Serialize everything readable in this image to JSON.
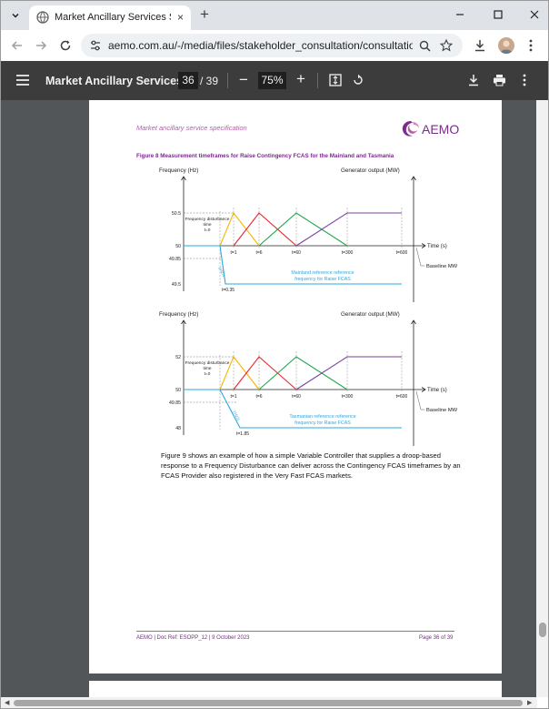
{
  "browser": {
    "tab_title": "Market Ancillary Services Specif...",
    "url": "aemo.com.au/-/media/files/stakeholder_consultation/consultations/...",
    "close_glyph": "×",
    "new_tab_glyph": "+",
    "window_minimize": "—",
    "window_maximize": "☐",
    "window_close": "✕"
  },
  "pdf_toolbar": {
    "title": "Market Ancillary Services...",
    "current_page": "36",
    "total_pages": "/ 39",
    "zoom": "75%",
    "minus": "−",
    "plus": "+"
  },
  "document": {
    "header": "Market ancillary service specification",
    "logo_text": "AEMO",
    "figure_caption": "Figure 8    Measurement timeframes for Raise Contingency FCAS for the Mainland and Tasmania",
    "body_paragraph": "Figure 9 shows an example of how a simple Variable Controller that supplies a droop-based response to a Frequency Disturbance can deliver across the Contingency FCAS timeframes by an FCAS Provider also registered in the Very Fast FCAS markets.",
    "footer_left": "AEMO | Doc Ref: ESOPP_12 | 9 October 2023",
    "footer_right": "Page 36 of 39"
  },
  "chart_data": [
    {
      "type": "line",
      "panel": "mainland",
      "ylabel": "Frequency (Hz)",
      "y2label": "Generator output (MW)",
      "xlabel": "Time (s)",
      "y_ticks": [
        "50.5",
        "50",
        "49.85",
        "49.5"
      ],
      "x_ticks": [
        "t=1",
        "t=6",
        "t=60",
        "t=300",
        "t=600"
      ],
      "extra_ticks": [
        "t=0.35"
      ],
      "annotations": [
        "Frequency disturbance time t=0",
        "Mainland reference frequency for Raise FCAS",
        "Baseline MW",
        "1Hz/s"
      ],
      "series": [
        {
          "color": "#f5b800",
          "x": [
            0,
            1,
            6
          ],
          "y": [
            0,
            1,
            0
          ]
        },
        {
          "color": "#e8262b",
          "x": [
            1,
            6,
            60
          ],
          "y": [
            0,
            1,
            0
          ]
        },
        {
          "color": "#1aa64a",
          "x": [
            6,
            60,
            300
          ],
          "y": [
            0,
            1,
            0
          ]
        },
        {
          "color": "#7b3fa0",
          "x": [
            60,
            300,
            600
          ],
          "y": [
            0,
            1,
            1
          ]
        },
        {
          "color": "#29a8e0",
          "x": [
            0,
            0.35,
            600
          ],
          "y": [
            50,
            49.5,
            49.5
          ]
        }
      ]
    },
    {
      "type": "line",
      "panel": "tasmania",
      "ylabel": "Frequency (Hz)",
      "y2label": "Generator output (MW)",
      "xlabel": "Time (s)",
      "y_ticks": [
        "52",
        "50",
        "49.85",
        "48"
      ],
      "x_ticks": [
        "t=1",
        "t=6",
        "t=60",
        "t=300",
        "t=600"
      ],
      "extra_ticks": [
        "t=1.85"
      ],
      "annotations": [
        "Frequency disturbance time t=0",
        "Tasmanian reference frequency for Raise FCAS",
        "Baseline MW",
        "1Hz/s"
      ],
      "series": [
        {
          "color": "#f5b800",
          "x": [
            0,
            1,
            6
          ],
          "y": [
            0,
            1,
            0
          ]
        },
        {
          "color": "#e8262b",
          "x": [
            1,
            6,
            60
          ],
          "y": [
            0,
            1,
            0
          ]
        },
        {
          "color": "#1aa64a",
          "x": [
            6,
            60,
            300
          ],
          "y": [
            0,
            1,
            0
          ]
        },
        {
          "color": "#7b3fa0",
          "x": [
            60,
            300,
            600
          ],
          "y": [
            0,
            1,
            1
          ]
        },
        {
          "color": "#29a8e0",
          "x": [
            0,
            1.85,
            600
          ],
          "y": [
            50,
            48,
            48
          ]
        }
      ]
    }
  ]
}
